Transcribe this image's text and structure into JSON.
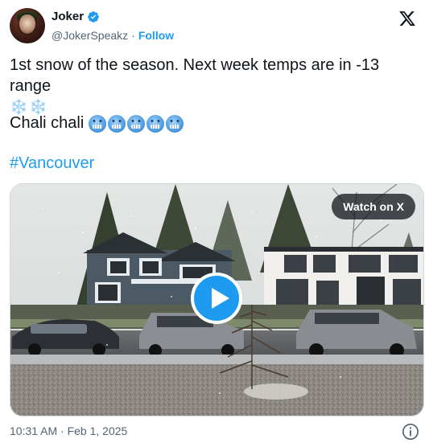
{
  "author": {
    "display_name": "Joker",
    "handle": "@JokerSpeakz",
    "separator": "·",
    "follow_label": "Follow",
    "verified": true
  },
  "tweet": {
    "line1": "1st snow of the season. Next week temps are in -13 range",
    "line1_emoji": "❄️❄️",
    "line2": "Chali chali",
    "line2_emoji_count": 5,
    "hashtag": "#Vancouver"
  },
  "media": {
    "watch_label": "Watch on X",
    "type": "video"
  },
  "footer": {
    "timestamp": "10:31 AM · Feb 1, 2025"
  },
  "icons": {
    "platform": "x-logo-icon",
    "verified": "verified-badge-icon",
    "info": "info-icon",
    "play": "play-icon"
  },
  "colors": {
    "accent": "#1d9bf0",
    "text": "#0f1419",
    "secondary": "#536471"
  }
}
